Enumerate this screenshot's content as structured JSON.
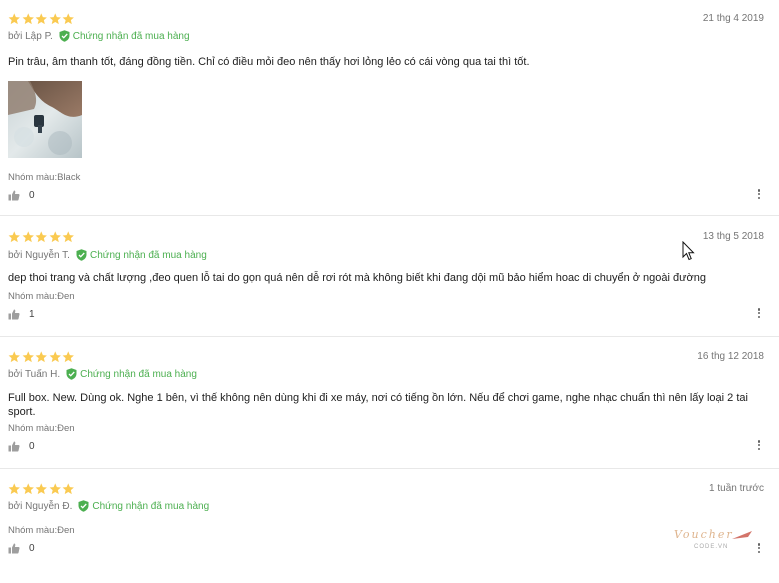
{
  "reviews": [
    {
      "rating": 5,
      "date": "21 thg 4 2019",
      "author": "bởi Lập P.",
      "verified": "Chứng nhận đã mua hàng",
      "content": "Pin trâu, âm thanh tốt, đáng đồng tiền. Chỉ có điều mỏi đeo nên thấy hơi lỏng lẻo có cái vòng qua tai thì tốt.",
      "sku": "Nhóm màu:Black",
      "likes": "0",
      "has_image": true
    },
    {
      "rating": 5,
      "date": "13 thg 5 2018",
      "author": "bởi Nguyễn T.",
      "verified": "Chứng nhận đã mua hàng",
      "content": "dep thoi trang và chất lượng ,đeo quen lỗ tai do gọn quá nên dễ rơi rót mà không biết khi đang dội mũ bảo hiểm hoac di chuyển ở ngoài đường",
      "sku": "Nhóm màu:Đen",
      "likes": "1",
      "has_image": false
    },
    {
      "rating": 5,
      "date": "16 thg 12 2018",
      "author": "bởi Tuấn H.",
      "verified": "Chứng nhận đã mua hàng",
      "content": "Full box. New. Dùng ok. Nghe 1 bên, vì thế không nên dùng khi đi xe máy, nơi có tiếng ồn lớn. Nếu để chơi game, nghe nhạc chuẩn thì nên lấy loại 2 tai sport.",
      "sku": "Nhóm màu:Đen",
      "likes": "0",
      "has_image": false
    },
    {
      "rating": 5,
      "date": "1 tuần trước",
      "author": "bởi Nguyễn Đ.",
      "verified": "Chứng nhận đã mua hàng",
      "content": "",
      "sku": "Nhóm màu:Đen",
      "likes": "0",
      "has_image": false
    }
  ],
  "watermark": {
    "line1": "Voucher",
    "line2": "CODE.VN"
  },
  "colors": {
    "star": "#faca51",
    "verified": "#4caf50",
    "muted_text": "#757575"
  },
  "icons": {
    "star": "star-icon",
    "verified": "shield-check-icon",
    "like": "thumbs-up-icon",
    "more": "more-vertical-icon"
  }
}
